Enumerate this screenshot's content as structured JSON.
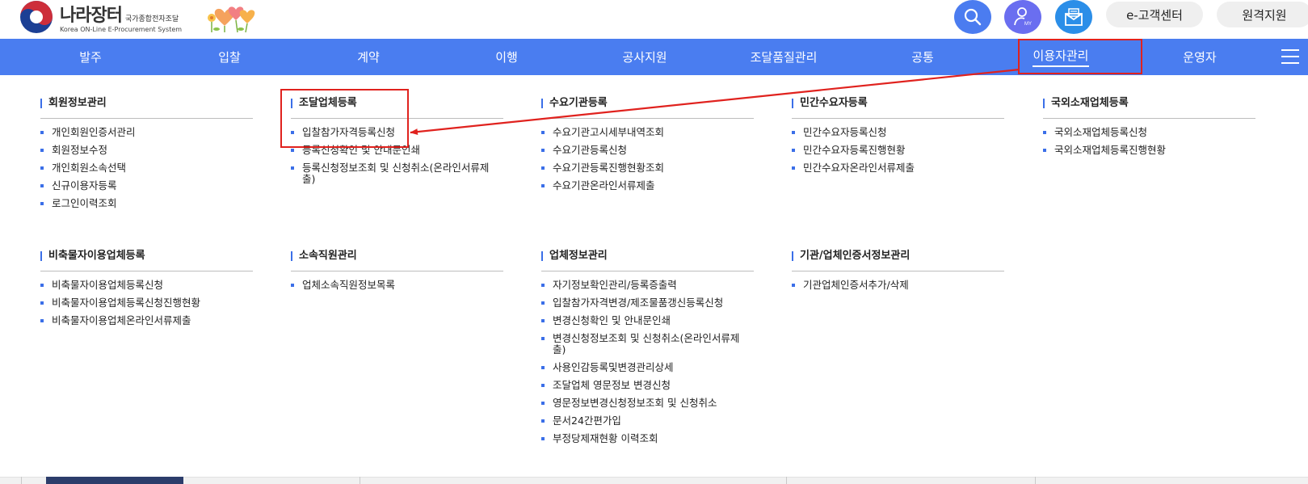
{
  "header": {
    "logo_title": "나라장터",
    "logo_sub": "국가종합전자조달",
    "logo_en": "Korea ON-Line E-Procurement System",
    "my_label": "MY",
    "cs_button": "e-고객센터",
    "remote_button": "원격지원",
    "colors": {
      "search": "#4b7cf0",
      "my": "#6a6ef0",
      "mail": "#2b8ee8"
    }
  },
  "nav": {
    "items": [
      "발주",
      "입찰",
      "계약",
      "이행",
      "공사지원",
      "조달품질관리",
      "공통",
      "이용자관리",
      "운영자"
    ],
    "active": "이용자관리",
    "color": "#4a7df0"
  },
  "menu": {
    "groups": [
      {
        "title": "회원정보관리",
        "items": [
          "개인회원인증서관리",
          "회원정보수정",
          "개인회원소속선택",
          "신규이용자등록",
          "로그인이력조회"
        ]
      },
      {
        "title": "조달업체등록",
        "items": [
          "입찰참가자격등록신청",
          "등록신청확인 및 안내문인쇄",
          "등록신청정보조회 및 신청취소(온라인서류제출)"
        ]
      },
      {
        "title": "수요기관등록",
        "items": [
          "수요기관고시세부내역조회",
          "수요기관등록신청",
          "수요기관등록진행현황조회",
          "수요기관온라인서류제출"
        ]
      },
      {
        "title": "민간수요자등록",
        "items": [
          "민간수요자등록신청",
          "민간수요자등록진행현황",
          "민간수요자온라인서류제출"
        ]
      },
      {
        "title": "국외소재업체등록",
        "items": [
          "국외소재업체등록신청",
          "국외소재업체등록진행현황"
        ]
      },
      {
        "title": "비축물자이용업체등록",
        "items": [
          "비축물자이용업체등록신청",
          "비축물자이용업체등록신청진행현황",
          "비축물자이용업체온라인서류제출"
        ]
      },
      {
        "title": "소속직원관리",
        "items": [
          "업체소속직원정보목록"
        ]
      },
      {
        "title": "업체정보관리",
        "items": [
          "자기정보확인관리/등록증출력",
          "입찰참가자격변경/제조물품갱신등록신청",
          "변경신청확인 및 안내문인쇄",
          "변경신청정보조회 및 신청취소(온라인서류제출)",
          "사용인감등록및변경관리상세",
          "조달업체 영문정보 변경신청",
          "영문정보변경신청정보조회 및 신청취소",
          "문서24간편가입",
          "부정당제재현황 이력조회"
        ]
      },
      {
        "title": "기관/업체인증서정보관리",
        "items": [
          "기관업체인증서추가/삭제"
        ]
      }
    ]
  },
  "annotation": {
    "color": "#e0221e"
  }
}
